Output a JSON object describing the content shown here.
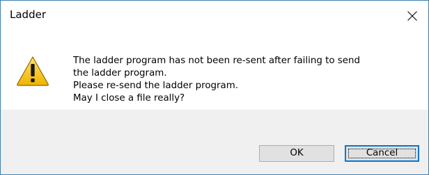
{
  "dialog": {
    "title": "Ladder",
    "close_icon": "close-icon",
    "warning_icon": "warning-icon",
    "message_lines": [
      "The ladder program has not been re-sent after failing to send",
      "the ladder program.",
      "Please re-send the ladder program.",
      "May I close a file really?"
    ],
    "buttons": {
      "ok_label": "OK",
      "cancel_label": "Cancel"
    }
  },
  "colors": {
    "window_border": "#3c7fb1",
    "footer_background": "#f0f0f0",
    "button_background": "#e1e1e1",
    "default_button_border": "#0078d7",
    "warning_yellow": "#f5c400"
  }
}
